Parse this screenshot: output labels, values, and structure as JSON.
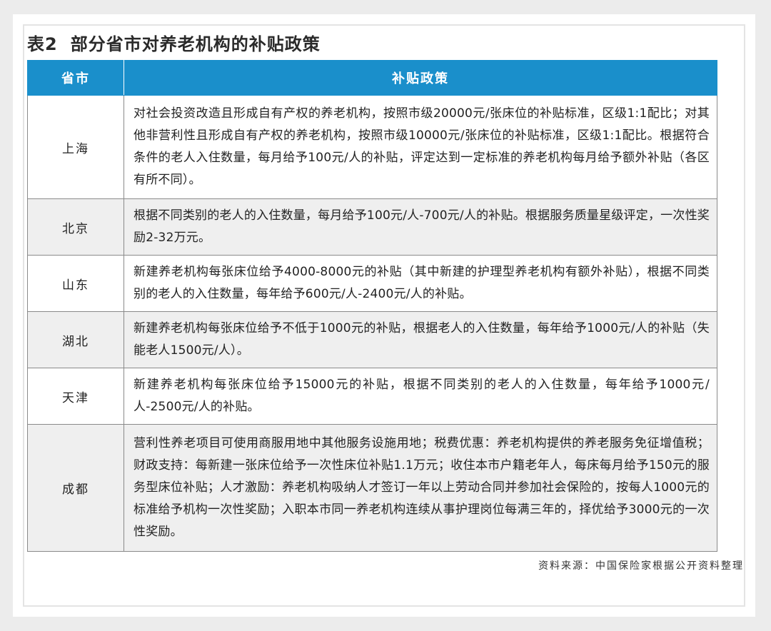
{
  "title": {
    "number": "表2",
    "text": "部分省市对养老机构的补贴政策"
  },
  "table": {
    "headers": {
      "province": "省市",
      "policy": "补贴政策"
    },
    "rows": [
      {
        "province": "上海",
        "policy": "对社会投资改造且形成自有产权的养老机构，按照市级20000元/张床位的补贴标准，区级1:1配比；对其他非营利性且形成自有产权的养老机构，按照市级10000元/张床位的补贴标准，区级1:1配比。根据符合条件的老人入住数量，每月给予100元/人的补贴，评定达到一定标准的养老机构每月给予额外补贴（各区有所不同）。"
      },
      {
        "province": "北京",
        "policy": "根据不同类别的老人的入住数量，每月给予100元/人-700元/人的补贴。根据服务质量星级评定，一次性奖励2-32万元。"
      },
      {
        "province": "山东",
        "policy": "新建养老机构每张床位给予4000-8000元的补贴（其中新建的护理型养老机构有额外补贴），根据不同类别的老人的入住数量，每年给予600元/人-2400元/人的补贴。"
      },
      {
        "province": "湖北",
        "policy": "新建养老机构每张床位给予不低于1000元的补贴，根据老人的入住数量，每年给予1000元/人的补贴（失能老人1500元/人）。"
      },
      {
        "province": "天津",
        "policy": "新建养老机构每张床位给予15000元的补贴，根据不同类别的老人的入住数量，每年给予1000元/人-2500元/人的补贴。"
      },
      {
        "province": "成都",
        "policy": "营利性养老项目可使用商服用地中其他服务设施用地；税费优惠：养老机构提供的养老服务免征增值税；财政支持：每新建一张床位给予一次性床位补贴1.1万元；收住本市户籍老年人，每床每月给予150元的服务型床位补贴；人才激励：养老机构吸纳人才签订一年以上劳动合同并参加社会保险的，按每人1000元的标准给予机构一次性奖励；入职本市同一养老机构连续从事护理岗位每满三年的，择优给予3000元的一次性奖励。"
      }
    ]
  },
  "source": "资料来源：中国保险家根据公开资料整理",
  "colors": {
    "header_bg": "#1a8fcb",
    "header_text": "#ffffff",
    "shaded_row": "#efefef",
    "border": "#8a8a8a"
  }
}
